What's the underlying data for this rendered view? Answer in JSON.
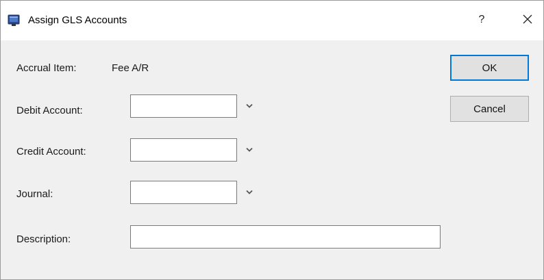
{
  "window": {
    "title": "Assign GLS Accounts",
    "help_label": "?",
    "icons": {
      "app": "app-window-icon",
      "close": "close-icon",
      "dropdown": "chevron-down-icon"
    }
  },
  "form": {
    "accrual_item_label": "Accrual Item:",
    "accrual_item_value": "Fee A/R",
    "debit_account_label": "Debit Account:",
    "debit_account_value": "",
    "credit_account_label": "Credit Account:",
    "credit_account_value": "",
    "journal_label": "Journal:",
    "journal_value": "",
    "description_label": "Description:",
    "description_value": ""
  },
  "buttons": {
    "ok_label": "OK",
    "cancel_label": "Cancel"
  },
  "colors": {
    "focus_border": "#0078d7",
    "chevron": "#555555"
  }
}
